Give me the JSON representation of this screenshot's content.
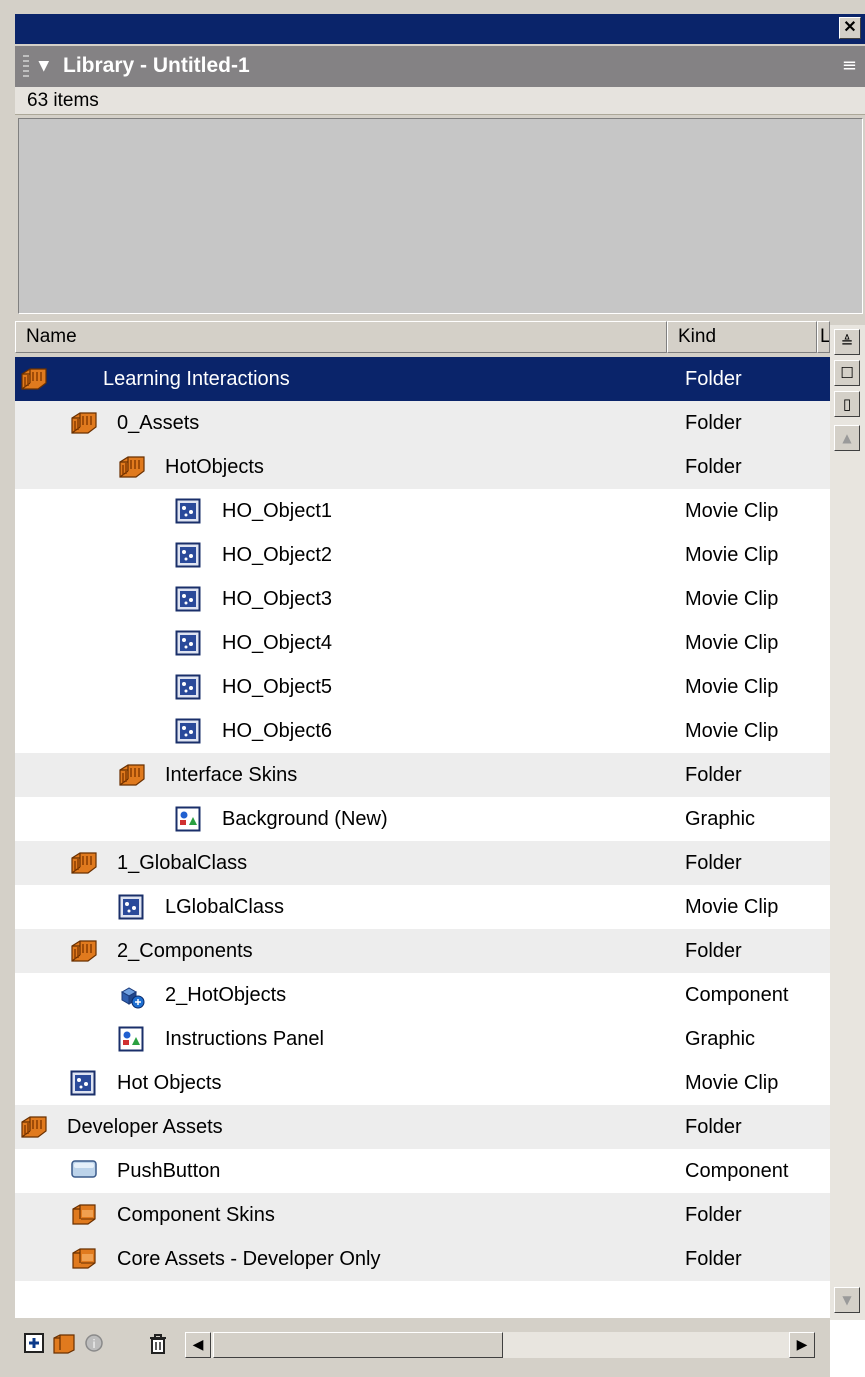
{
  "window": {
    "close_label": "✕"
  },
  "library": {
    "arrow": "▾",
    "title": "Library - Untitled-1",
    "options_icon": "≡",
    "count": "63 items"
  },
  "columns": {
    "name": "Name",
    "kind": "Kind",
    "linkage": "L"
  },
  "scrollbar": {
    "sort_toggle": "≜",
    "wide_view": "☐",
    "narrow_view": "▯",
    "up": "▲",
    "down": "▼",
    "left": "◀",
    "right": "▶"
  },
  "items": [
    {
      "name": "Learning Interactions",
      "kind": "Folder",
      "icon": "folder-open-icon",
      "indent": 0,
      "selected": true
    },
    {
      "name": "0_Assets",
      "kind": "Folder",
      "icon": "folder-open-icon",
      "indent": 1
    },
    {
      "name": "HotObjects",
      "kind": "Folder",
      "icon": "folder-open-icon",
      "indent": 2
    },
    {
      "name": "HO_Object1",
      "kind": "Movie Clip",
      "icon": "movie-clip-icon",
      "indent": 3
    },
    {
      "name": "HO_Object2",
      "kind": "Movie Clip",
      "icon": "movie-clip-icon",
      "indent": 3
    },
    {
      "name": "HO_Object3",
      "kind": "Movie Clip",
      "icon": "movie-clip-icon",
      "indent": 3
    },
    {
      "name": "HO_Object4",
      "kind": "Movie Clip",
      "icon": "movie-clip-icon",
      "indent": 3
    },
    {
      "name": "HO_Object5",
      "kind": "Movie Clip",
      "icon": "movie-clip-icon",
      "indent": 3
    },
    {
      "name": "HO_Object6",
      "kind": "Movie Clip",
      "icon": "movie-clip-icon",
      "indent": 3
    },
    {
      "name": "Interface Skins",
      "kind": "Folder",
      "icon": "folder-open-icon",
      "indent": 2
    },
    {
      "name": "Background (New)",
      "kind": "Graphic",
      "icon": "graphic-icon",
      "indent": 3
    },
    {
      "name": "1_GlobalClass",
      "kind": "Folder",
      "icon": "folder-open-icon",
      "indent": 1
    },
    {
      "name": "LGlobalClass",
      "kind": "Movie Clip",
      "icon": "movie-clip-icon",
      "indent": 2
    },
    {
      "name": "2_Components",
      "kind": "Folder",
      "icon": "folder-open-icon",
      "indent": 1
    },
    {
      "name": "2_HotObjects",
      "kind": "Component",
      "icon": "component-icon",
      "indent": 2
    },
    {
      "name": "Instructions Panel",
      "kind": "Graphic",
      "icon": "graphic-icon",
      "indent": 2
    },
    {
      "name": "Hot Objects",
      "kind": "Movie Clip",
      "icon": "movie-clip-icon",
      "indent": 1
    },
    {
      "name": "Developer Assets",
      "kind": "Folder",
      "icon": "folder-open-icon",
      "indent": 0
    },
    {
      "name": "PushButton",
      "kind": "Component",
      "icon": "push-button-icon",
      "indent": 1
    },
    {
      "name": "Component Skins",
      "kind": "Folder",
      "icon": "folder-closed-icon",
      "indent": 1
    },
    {
      "name": "Core Assets - Developer Only",
      "kind": "Folder",
      "icon": "folder-closed-icon",
      "indent": 1
    }
  ],
  "toolbar": {
    "new_symbol_icon": "new-symbol-icon",
    "new_folder_icon": "new-folder-icon",
    "properties_icon": "properties-icon",
    "delete_icon": "trash-icon"
  },
  "colors": {
    "selection": "#0a246a",
    "panel": "#d4d0c8",
    "header": "#848284",
    "folder": "#e07a1e",
    "alt_row": "#ededed"
  }
}
